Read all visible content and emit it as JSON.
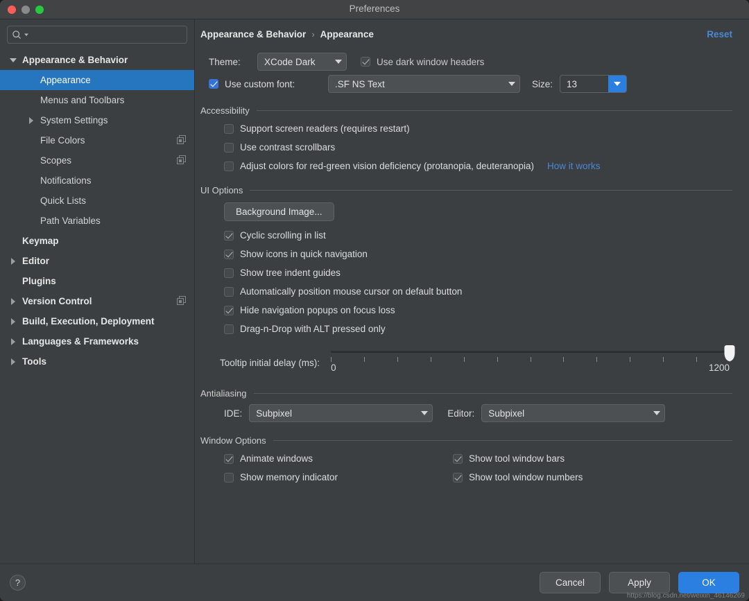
{
  "window": {
    "title": "Preferences",
    "accent_blue": "#2a7fe0",
    "link_blue": "#4a88d4",
    "selection_blue": "#2675bf",
    "background": "#3c3f41"
  },
  "search": {
    "value": "",
    "placeholder": ""
  },
  "sidebar": {
    "items": [
      {
        "label": "Appearance & Behavior",
        "level": 0,
        "twisty": "down",
        "group": true,
        "selected": false,
        "copy": false
      },
      {
        "label": "Appearance",
        "level": 1,
        "twisty": "none",
        "group": false,
        "selected": true,
        "copy": false
      },
      {
        "label": "Menus and Toolbars",
        "level": 1,
        "twisty": "none",
        "group": false,
        "selected": false,
        "copy": false
      },
      {
        "label": "System Settings",
        "level": 1,
        "twisty": "right",
        "group": false,
        "selected": false,
        "copy": false
      },
      {
        "label": "File Colors",
        "level": 1,
        "twisty": "none",
        "group": false,
        "selected": false,
        "copy": true
      },
      {
        "label": "Scopes",
        "level": 1,
        "twisty": "none",
        "group": false,
        "selected": false,
        "copy": true
      },
      {
        "label": "Notifications",
        "level": 1,
        "twisty": "none",
        "group": false,
        "selected": false,
        "copy": false
      },
      {
        "label": "Quick Lists",
        "level": 1,
        "twisty": "none",
        "group": false,
        "selected": false,
        "copy": false
      },
      {
        "label": "Path Variables",
        "level": 1,
        "twisty": "none",
        "group": false,
        "selected": false,
        "copy": false
      },
      {
        "label": "Keymap",
        "level": 0,
        "twisty": "none",
        "group": true,
        "selected": false,
        "copy": false
      },
      {
        "label": "Editor",
        "level": 0,
        "twisty": "right",
        "group": true,
        "selected": false,
        "copy": false
      },
      {
        "label": "Plugins",
        "level": 0,
        "twisty": "none",
        "group": true,
        "selected": false,
        "copy": false
      },
      {
        "label": "Version Control",
        "level": 0,
        "twisty": "right",
        "group": true,
        "selected": false,
        "copy": true
      },
      {
        "label": "Build, Execution, Deployment",
        "level": 0,
        "twisty": "right",
        "group": true,
        "selected": false,
        "copy": false
      },
      {
        "label": "Languages & Frameworks",
        "level": 0,
        "twisty": "right",
        "group": true,
        "selected": false,
        "copy": false
      },
      {
        "label": "Tools",
        "level": 0,
        "twisty": "right",
        "group": true,
        "selected": false,
        "copy": false
      }
    ]
  },
  "breadcrumb": {
    "parent": "Appearance & Behavior",
    "separator": "›",
    "current": "Appearance",
    "reset_label": "Reset"
  },
  "theme_row": {
    "label": "Theme:",
    "value": "XCode Dark",
    "dark_headers_label": "Use dark window headers",
    "dark_headers_checked": true,
    "dark_headers_enabled": false
  },
  "font_row": {
    "custom_font_label": "Use custom font:",
    "custom_font_checked": true,
    "font_value": ".SF NS Text",
    "size_label": "Size:",
    "size_value": "13"
  },
  "accessibility": {
    "title": "Accessibility",
    "options": [
      {
        "label": "Support screen readers (requires restart)",
        "checked": false
      },
      {
        "label": "Use contrast scrollbars",
        "checked": false
      },
      {
        "label": "Adjust colors for red-green vision deficiency (protanopia, deuteranopia)",
        "checked": false,
        "link": "How it works"
      }
    ]
  },
  "ui_options": {
    "title": "UI Options",
    "background_image_button": "Background Image...",
    "options": [
      {
        "label": "Cyclic scrolling in list",
        "checked": true
      },
      {
        "label": "Show icons in quick navigation",
        "checked": true
      },
      {
        "label": "Show tree indent guides",
        "checked": false
      },
      {
        "label": "Automatically position mouse cursor on default button",
        "checked": false
      },
      {
        "label": "Hide navigation popups on focus loss",
        "checked": true
      },
      {
        "label": "Drag-n-Drop with ALT pressed only",
        "checked": false
      }
    ],
    "tooltip_slider": {
      "label": "Tooltip initial delay (ms):",
      "min_label": "0",
      "max_label": "1200",
      "min": 0,
      "max": 1200,
      "value": 1200,
      "tick_count": 13
    }
  },
  "antialiasing": {
    "title": "Antialiasing",
    "ide_label": "IDE:",
    "ide_value": "Subpixel",
    "editor_label": "Editor:",
    "editor_value": "Subpixel"
  },
  "window_options": {
    "title": "Window Options",
    "left_column": [
      {
        "label": "Animate windows",
        "checked": true
      },
      {
        "label": "Show memory indicator",
        "checked": false
      }
    ],
    "right_column": [
      {
        "label": "Show tool window bars",
        "checked": true
      },
      {
        "label": "Show tool window numbers",
        "checked": true
      }
    ]
  },
  "footer": {
    "help_label": "?",
    "cancel_label": "Cancel",
    "apply_label": "Apply",
    "ok_label": "OK"
  },
  "watermark": "https://blog.csdn.net/weixin_46146269"
}
